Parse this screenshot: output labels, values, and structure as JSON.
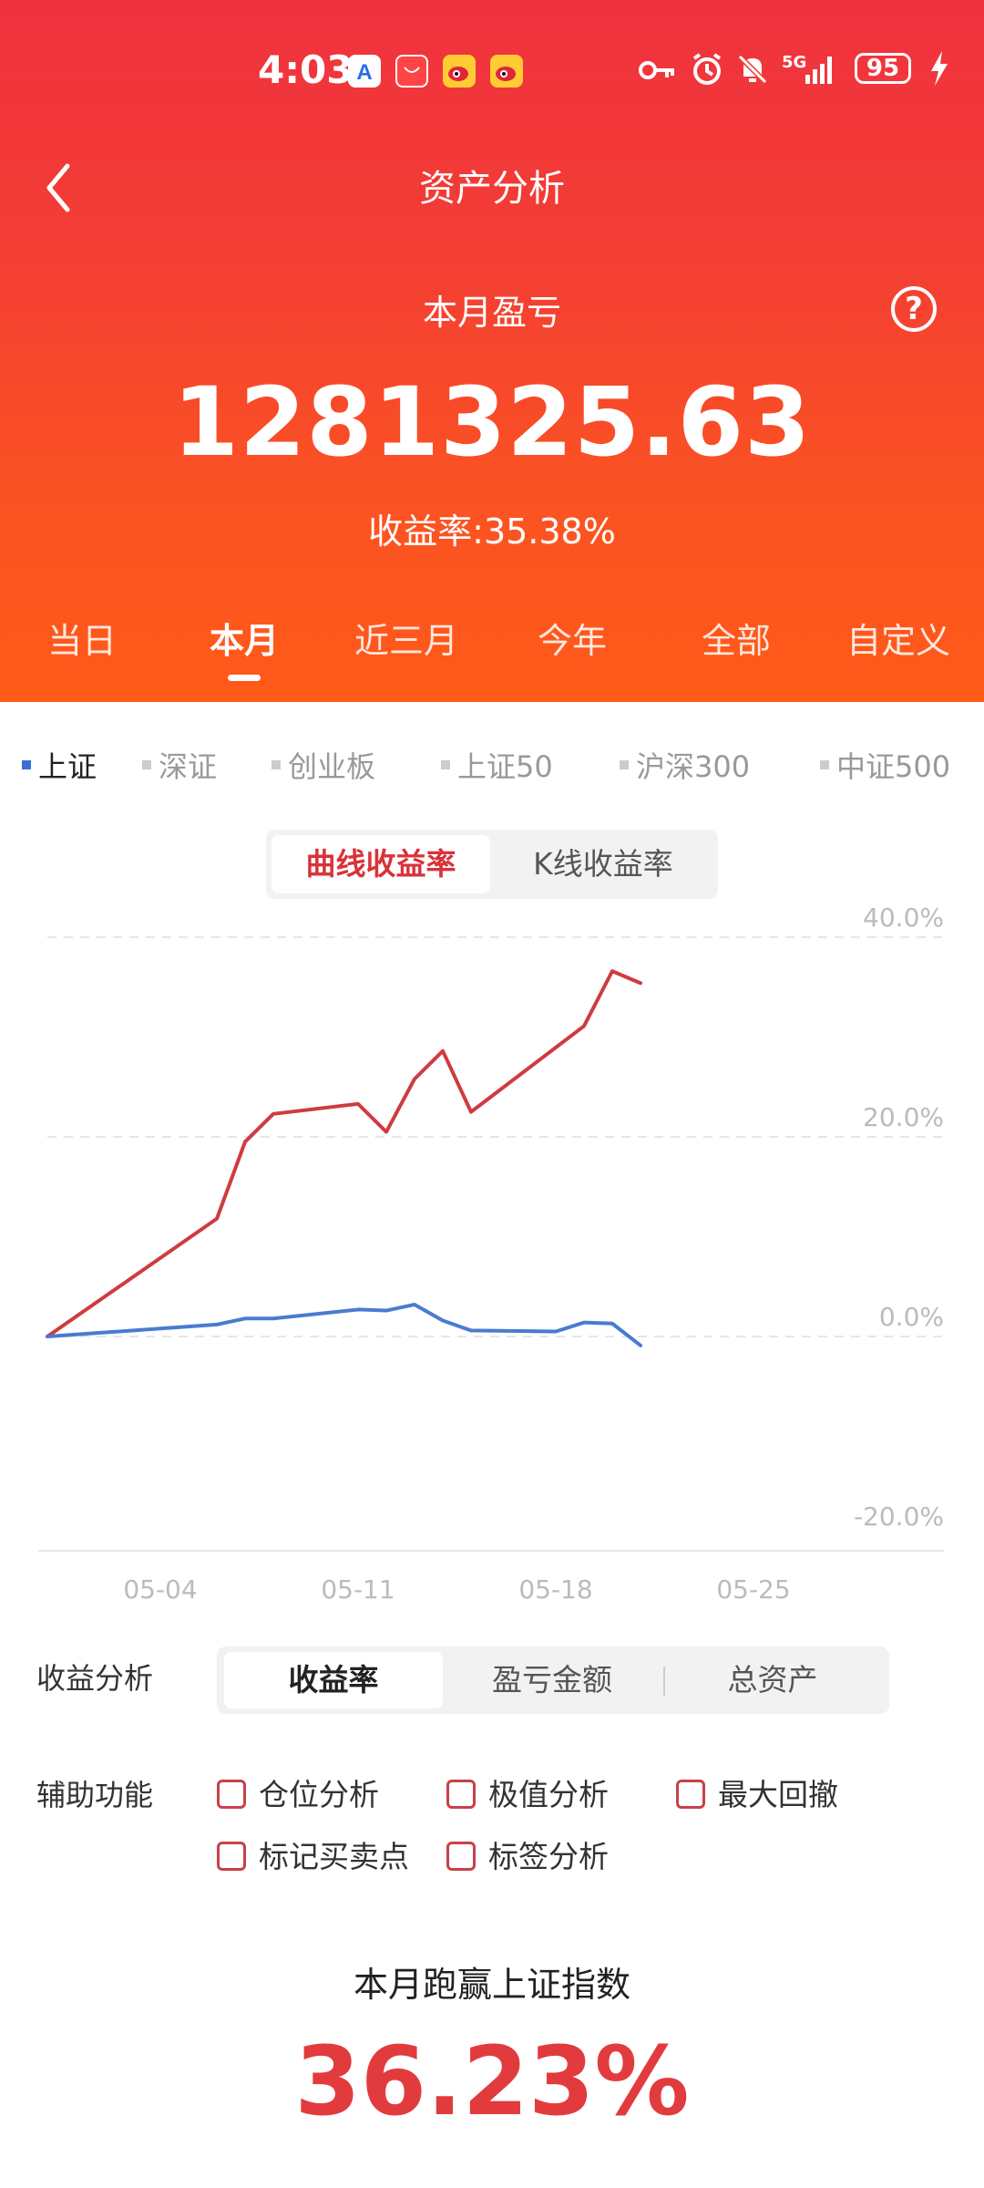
{
  "status_bar": {
    "time": "4:03",
    "battery": "95",
    "network": "5G",
    "icons": [
      "app-store-icon",
      "huawei-icon",
      "weibo-icon",
      "weibo-icon",
      "key-icon",
      "alarm-icon",
      "mute-bell-icon",
      "signal-icon",
      "battery-icon",
      "charging-icon"
    ]
  },
  "header": {
    "title": "资产分析",
    "subtitle": "本月盈亏",
    "amount": "1281325.63",
    "rate": "收益率:35.38%",
    "tabs": [
      "当日",
      "本月",
      "近三月",
      "今年",
      "全部",
      "自定义"
    ],
    "active_tab": "本月"
  },
  "legend": [
    {
      "label": "上证",
      "active": true
    },
    {
      "label": "深证",
      "active": false
    },
    {
      "label": "创业板",
      "active": false
    },
    {
      "label": "上证50",
      "active": false
    },
    {
      "label": "沪深300",
      "active": false
    },
    {
      "label": "中证500",
      "active": false
    }
  ],
  "chart_toggle": [
    "曲线收益率",
    "K线收益率"
  ],
  "chart_toggle_active": "曲线收益率",
  "chart_data": {
    "type": "line",
    "y_tick_labels": [
      "40.0%",
      "20.0%",
      "0.0%",
      "-20.0%"
    ],
    "x_tick_labels": [
      "05-04",
      "05-11",
      "05-18",
      "05-25"
    ],
    "ylim": [
      -20,
      40
    ],
    "grid": true,
    "x_range": [
      0,
      28
    ],
    "series": [
      {
        "name": "portfolio",
        "color": "#cf3b3f",
        "x": [
          0,
          6,
          7,
          8,
          11,
          12,
          13,
          14,
          15,
          19,
          20,
          21
        ],
        "values": [
          0,
          11.8,
          19.5,
          22.3,
          23.3,
          20.5,
          25.8,
          28.6,
          22.5,
          31.1,
          36.6,
          35.4
        ]
      },
      {
        "name": "上证",
        "color": "#4a7bcf",
        "x": [
          0,
          6,
          7,
          8,
          11,
          12,
          13,
          14,
          15,
          18,
          19,
          20,
          21
        ],
        "values": [
          0,
          1.2,
          1.8,
          1.8,
          2.7,
          2.6,
          3.2,
          1.6,
          0.6,
          0.5,
          1.4,
          1.3,
          -0.9
        ]
      }
    ]
  },
  "analysis": {
    "label": "收益分析",
    "options": [
      "收益率",
      "盈亏金额",
      "总资产"
    ],
    "active": "收益率"
  },
  "aux": {
    "label": "辅助功能",
    "options": [
      "仓位分析",
      "极值分析",
      "最大回撤",
      "标记买卖点",
      "标签分析"
    ]
  },
  "beat": {
    "title": "本月跑赢上证指数",
    "value": "36.23%"
  },
  "colors": {
    "header_top": "#f0323f",
    "header_bottom": "#ff5a18",
    "accent_red": "#e23b3e",
    "legend_blue": "#3a6fd8"
  }
}
